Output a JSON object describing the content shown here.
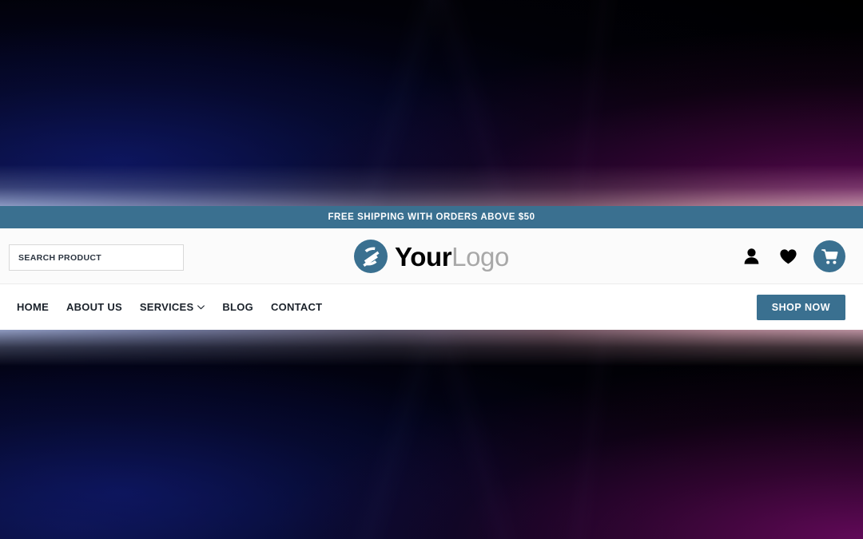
{
  "theme": {
    "accent_color": "#3a7090",
    "nav_text_color": "#1b222b",
    "logo_primary_color": "#000000",
    "logo_secondary_color": "#a8a8a8",
    "header_background": "#ffffff"
  },
  "announcement": {
    "text": "FREE SHIPPING WITH ORDERS ABOVE $50"
  },
  "search": {
    "placeholder": "SEARCH PRODUCT",
    "value": ""
  },
  "brand": {
    "logo_icon": "swoosh-circle-icon",
    "name_primary": "Your",
    "name_secondary": "Logo"
  },
  "header_actions": [
    {
      "icon": "user-icon",
      "label": "Account"
    },
    {
      "icon": "heart-icon",
      "label": "Wishlist"
    },
    {
      "icon": "shopping-cart-icon",
      "label": "Cart"
    }
  ],
  "nav": {
    "items": [
      {
        "label": "HOME",
        "has_dropdown": false
      },
      {
        "label": "ABOUT US",
        "has_dropdown": false
      },
      {
        "label": "SERVICES",
        "has_dropdown": true,
        "dropdown_icon": "chevron-down-icon"
      },
      {
        "label": "BLOG",
        "has_dropdown": false
      },
      {
        "label": "CONTACT",
        "has_dropdown": false
      }
    ],
    "cta_label": "SHOP NOW"
  }
}
